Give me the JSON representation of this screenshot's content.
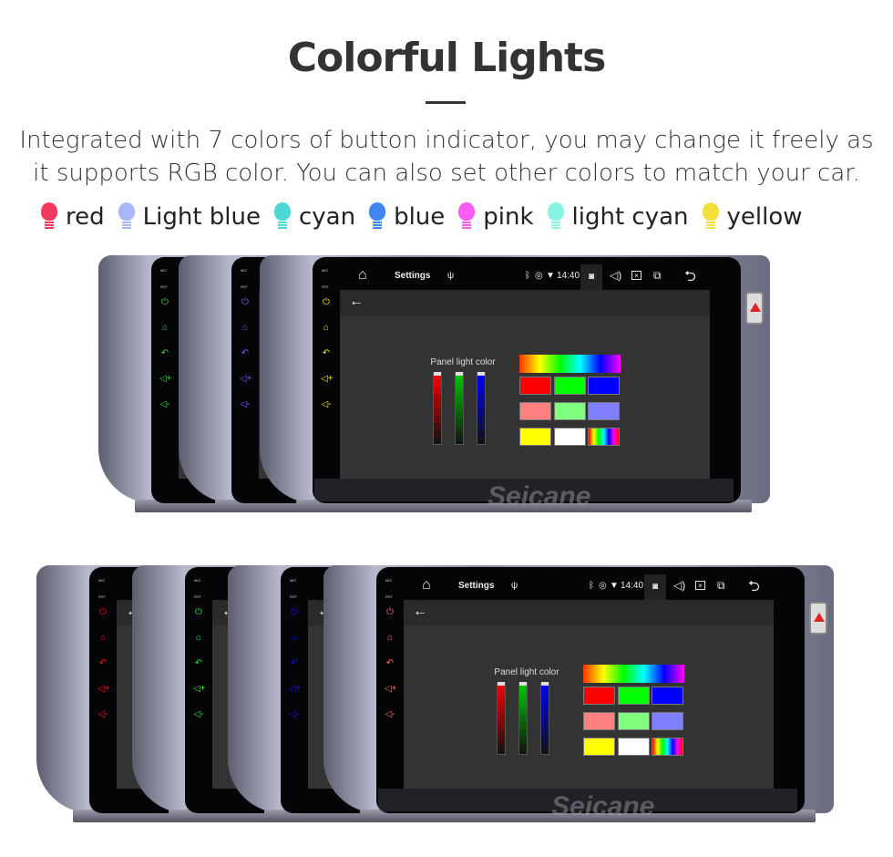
{
  "heading": "Colorful Lights",
  "description": [
    "Integrated with 7 colors of button indicator, you may change it freely as",
    "it supports RGB color. You can also set other colors to match your car."
  ],
  "legend": [
    {
      "label": "red",
      "color": "#f23a5e"
    },
    {
      "label": "Light blue",
      "color": "#a9b8f5"
    },
    {
      "label": "cyan",
      "color": "#4fd6d6"
    },
    {
      "label": "blue",
      "color": "#3f86f3"
    },
    {
      "label": "pink",
      "color": "#f65cf0"
    },
    {
      "label": "light cyan",
      "color": "#88f3e2"
    },
    {
      "label": "yellow",
      "color": "#f2df3c"
    }
  ],
  "unit": {
    "mic": "MIC",
    "rst": "RST",
    "status_title": "Settings",
    "time": "14:40",
    "panel_label": "Panel light color",
    "watermark": "Seicane",
    "swatches": [
      "#ff0000",
      "#00ff00",
      "#0000ff",
      "#ff8080",
      "#80ff80",
      "#8080ff",
      "#ffff00",
      "#ffffff",
      "rainbow"
    ]
  },
  "top_group_button_colors": [
    "#33dd33",
    "#6666ff",
    "#eeee00"
  ],
  "bottom_group_button_colors": [
    "#ff1111",
    "#22ee22",
    "#1111ff",
    "#ff6666"
  ]
}
